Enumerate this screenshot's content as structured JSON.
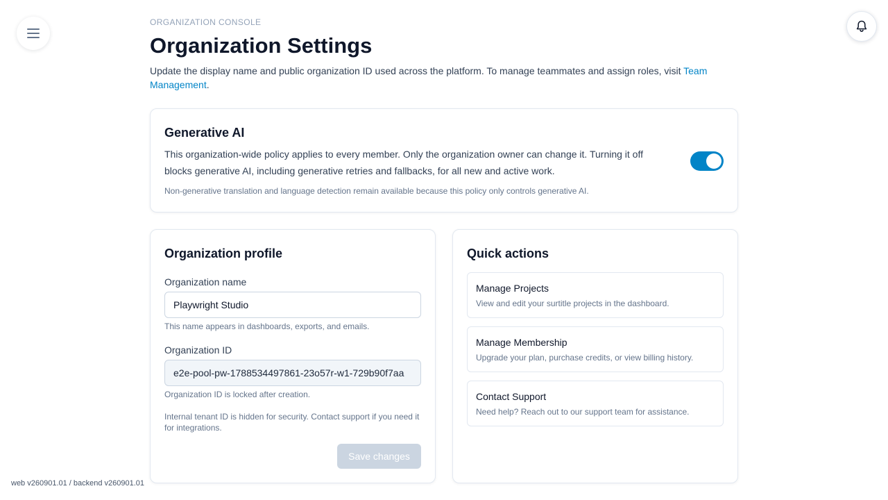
{
  "header": {
    "eyebrow": "ORGANIZATION CONSOLE",
    "title": "Organization Settings",
    "intro_text": "Update the display name and public organization ID used across the platform. To manage teammates and assign roles, visit ",
    "intro_link": "Team Management",
    "intro_end": "."
  },
  "icons": {
    "menu": "hamburger-menu-icon",
    "notifications": "bell-icon"
  },
  "generative_ai": {
    "title": "Generative AI",
    "description": "This organization-wide policy applies to every member. Only the organization owner can change it. Turning it off blocks generative AI, including generative retries and fallbacks, for all new and active work.",
    "note": "Non-generative translation and language detection remain available because this policy only controls generative AI.",
    "enabled": true
  },
  "profile": {
    "title": "Organization profile",
    "name_label": "Organization name",
    "name_value": "Playwright Studio",
    "name_help": "This name appears in dashboards, exports, and emails.",
    "id_label": "Organization ID",
    "id_value": "e2e-pool-pw-1788534497861-23o57r-w1-729b90f7aa",
    "id_help": "Organization ID is locked after creation.",
    "tenant_note": "Internal tenant ID is hidden for security. Contact support if you need it for integrations.",
    "save_label": "Save changes"
  },
  "quick_actions": {
    "title": "Quick actions",
    "items": [
      {
        "title": "Manage Projects",
        "description": "View and edit your surtitle projects in the dashboard."
      },
      {
        "title": "Manage Membership",
        "description": "Upgrade your plan, purchase credits, or view billing history."
      },
      {
        "title": "Contact Support",
        "description": "Need help? Reach out to our support team for assistance."
      }
    ]
  },
  "footer": {
    "version": "web v260901.01 / backend v260901.01"
  },
  "colors": {
    "accent": "#0284c7",
    "disabled_button": "#cbd5e1"
  }
}
